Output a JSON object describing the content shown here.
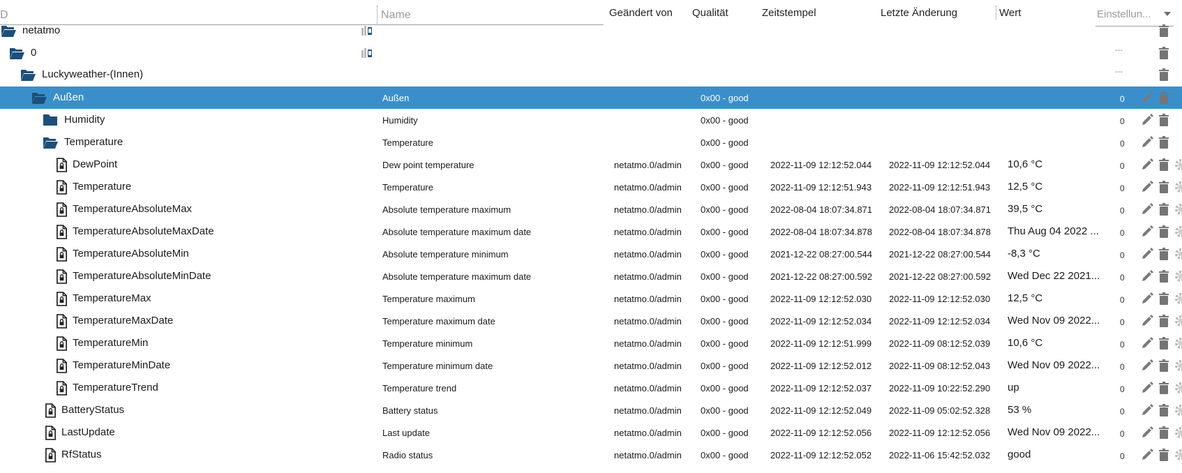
{
  "header": {
    "id_placeholder": "D",
    "name_placeholder": "Name",
    "col_changed_by": "Geändert von",
    "col_quality": "Qualität",
    "col_timestamp": "Zeitstempel",
    "col_last_change": "Letzte Änderung",
    "col_value": "Wert",
    "settings_label": "Einstellun..."
  },
  "rows": [
    {
      "id": "netatmo",
      "name": "",
      "changed_by": "",
      "quality": "",
      "ts": "",
      "lc": "",
      "value": "",
      "extra": ""
    },
    {
      "id": "0",
      "name": "",
      "changed_by": "",
      "quality": "",
      "ts": "",
      "lc": "",
      "value": "",
      "extra": "---"
    },
    {
      "id": "Luckyweather-(Innen)",
      "name": "",
      "changed_by": "",
      "quality": "",
      "ts": "",
      "lc": "",
      "value": "",
      "extra": "---"
    },
    {
      "id": "Außen",
      "name": "Außen",
      "changed_by": "",
      "quality": "0x00 - good",
      "ts": "",
      "lc": "",
      "value": "",
      "extra": "0"
    },
    {
      "id": "Humidity",
      "name": "Humidity",
      "changed_by": "",
      "quality": "0x00 - good",
      "ts": "",
      "lc": "",
      "value": "",
      "extra": "0"
    },
    {
      "id": "Temperature",
      "name": "Temperature",
      "changed_by": "",
      "quality": "0x00 - good",
      "ts": "",
      "lc": "",
      "value": "",
      "extra": "0"
    },
    {
      "id": "DewPoint",
      "name": "Dew point temperature",
      "changed_by": "netatmo.0/admin",
      "quality": "0x00 - good",
      "ts": "2022-11-09 12:12:52.044",
      "lc": "2022-11-09 12:12:52.044",
      "value": "10,6 °C",
      "extra": "0"
    },
    {
      "id": "Temperature",
      "name": "Temperature",
      "changed_by": "netatmo.0/admin",
      "quality": "0x00 - good",
      "ts": "2022-11-09 12:12:51.943",
      "lc": "2022-11-09 12:12:51.943",
      "value": "12,5 °C",
      "extra": "0"
    },
    {
      "id": "TemperatureAbsoluteMax",
      "name": "Absolute temperature maximum",
      "changed_by": "netatmo.0/admin",
      "quality": "0x00 - good",
      "ts": "2022-08-04 18:07:34.871",
      "lc": "2022-08-04 18:07:34.871",
      "value": "39,5 °C",
      "extra": "0"
    },
    {
      "id": "TemperatureAbsoluteMaxDate",
      "name": "Absolute temperature maximum date",
      "changed_by": "netatmo.0/admin",
      "quality": "0x00 - good",
      "ts": "2022-08-04 18:07:34.878",
      "lc": "2022-08-04 18:07:34.878",
      "value": "Thu Aug 04 2022 ...",
      "extra": "0"
    },
    {
      "id": "TemperatureAbsoluteMin",
      "name": "Absolute temperature minimum",
      "changed_by": "netatmo.0/admin",
      "quality": "0x00 - good",
      "ts": "2021-12-22 08:27:00.544",
      "lc": "2021-12-22 08:27:00.544",
      "value": "-8,3 °C",
      "extra": "0"
    },
    {
      "id": "TemperatureAbsoluteMinDate",
      "name": "Absolute temperature maximum date",
      "changed_by": "netatmo.0/admin",
      "quality": "0x00 - good",
      "ts": "2021-12-22 08:27:00.592",
      "lc": "2021-12-22 08:27:00.592",
      "value": "Wed Dec 22 2021...",
      "extra": "0"
    },
    {
      "id": "TemperatureMax",
      "name": "Temperature maximum",
      "changed_by": "netatmo.0/admin",
      "quality": "0x00 - good",
      "ts": "2022-11-09 12:12:52.030",
      "lc": "2022-11-09 12:12:52.030",
      "value": "12,5 °C",
      "extra": "0"
    },
    {
      "id": "TemperatureMaxDate",
      "name": "Temperature maximum date",
      "changed_by": "netatmo.0/admin",
      "quality": "0x00 - good",
      "ts": "2022-11-09 12:12:52.034",
      "lc": "2022-11-09 12:12:52.034",
      "value": "Wed Nov 09 2022...",
      "extra": "0"
    },
    {
      "id": "TemperatureMin",
      "name": "Temperature minimum",
      "changed_by": "netatmo.0/admin",
      "quality": "0x00 - good",
      "ts": "2022-11-09 12:12:51.999",
      "lc": "2022-11-09 08:12:52.039",
      "value": "10,6 °C",
      "extra": "0"
    },
    {
      "id": "TemperatureMinDate",
      "name": "Temperature minimum date",
      "changed_by": "netatmo.0/admin",
      "quality": "0x00 - good",
      "ts": "2022-11-09 12:12:52.012",
      "lc": "2022-11-09 08:12:52.043",
      "value": "Wed Nov 09 2022...",
      "extra": "0"
    },
    {
      "id": "TemperatureTrend",
      "name": "Temperature trend",
      "changed_by": "netatmo.0/admin",
      "quality": "0x00 - good",
      "ts": "2022-11-09 12:12:52.037",
      "lc": "2022-11-09 10:22:52.290",
      "value": "up",
      "extra": "0"
    },
    {
      "id": "BatteryStatus",
      "name": "Battery status",
      "changed_by": "netatmo.0/admin",
      "quality": "0x00 - good",
      "ts": "2022-11-09 12:12:52.049",
      "lc": "2022-11-09 05:02:52.328",
      "value": "53 %",
      "extra": "0"
    },
    {
      "id": "LastUpdate",
      "name": "Last update",
      "changed_by": "netatmo.0/admin",
      "quality": "0x00 - good",
      "ts": "2022-11-09 12:12:52.056",
      "lc": "2022-11-09 12:12:52.056",
      "value": "Wed Nov 09 2022...",
      "extra": "0"
    },
    {
      "id": "RfStatus",
      "name": "Radio status",
      "changed_by": "netatmo.0/admin",
      "quality": "0x00 - good",
      "ts": "2022-11-09 12:12:52.052",
      "lc": "2022-11-06 15:42:52.032",
      "value": "good",
      "extra": "0"
    }
  ],
  "colors": {
    "selected_row": "#3a8fcb",
    "folder": "#1d4f7a",
    "icon_gray": "#757575"
  },
  "icons": [
    "folder-open-icon",
    "folder-closed-icon",
    "state-file-icon",
    "pencil-icon",
    "trash-icon",
    "gear-icon",
    "role-icon"
  ]
}
